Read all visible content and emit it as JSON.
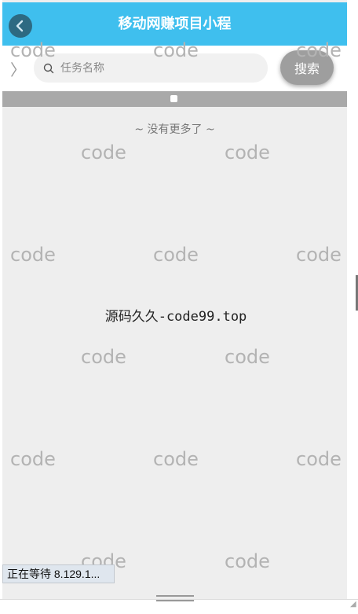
{
  "header": {
    "title": "移动网赚项目小程",
    "back_icon": "back-arrow-icon"
  },
  "search": {
    "side_arrow": "〉",
    "placeholder": "任务名称",
    "value": "",
    "button_label": "搜索"
  },
  "list": {
    "no_more_text": "~ 没有更多了 ~"
  },
  "overlay": {
    "center_text": "源码久久-code99.top",
    "watermarks": [
      "code",
      "code",
      "code",
      "code",
      "code",
      "code",
      "code",
      "code",
      "code",
      "code",
      "code",
      "code",
      "code",
      "code",
      "code",
      "code",
      "code",
      "code",
      "code",
      "code"
    ]
  },
  "status": {
    "text": "正在等待 8.129.1..."
  },
  "colors": {
    "header_bg": "#3fbfee",
    "search_button": "#9e9e9e",
    "banner": "#a9a9a9"
  }
}
